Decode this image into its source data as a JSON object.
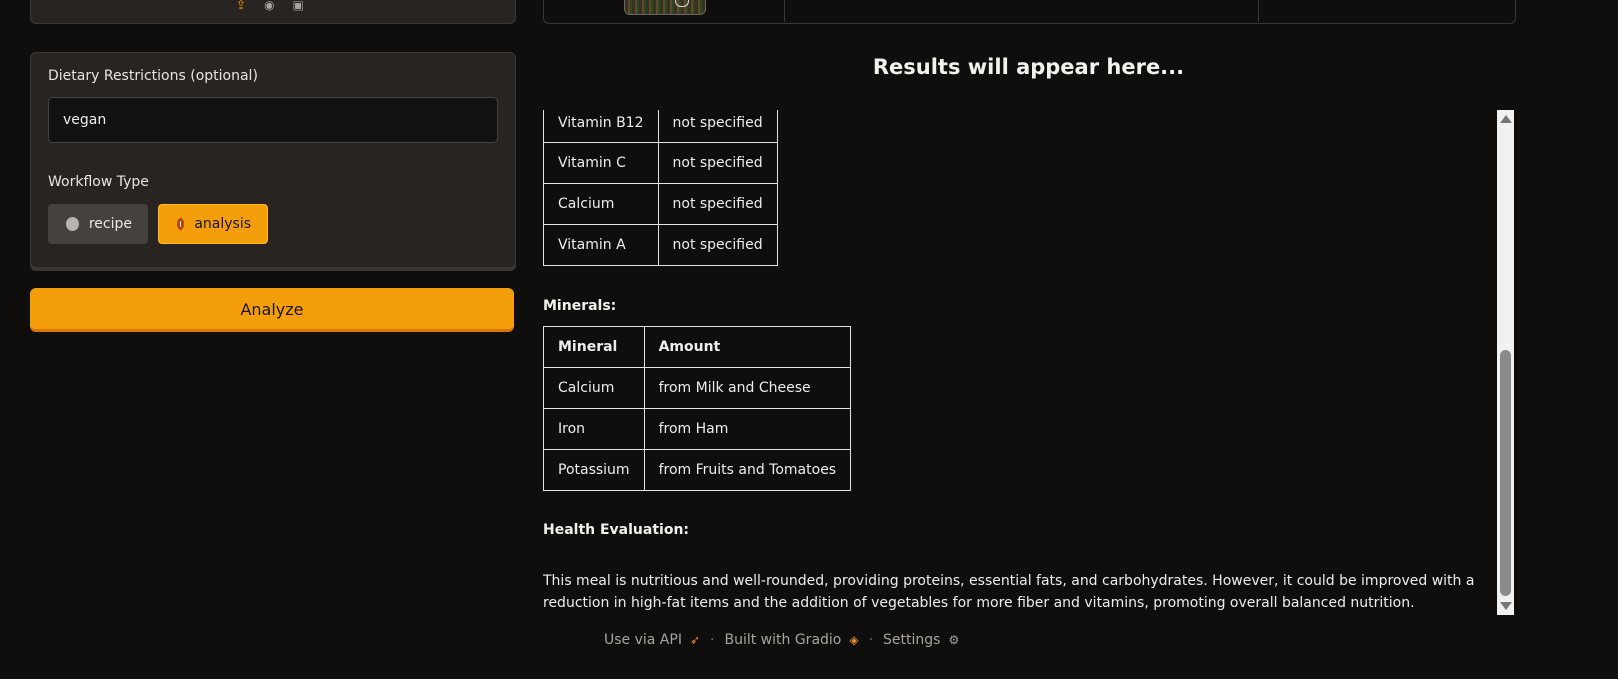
{
  "upload_panel": {
    "icons": [
      "upload-icon",
      "webcam-icon",
      "clipboard-icon"
    ]
  },
  "form": {
    "dietary_label": "Dietary Restrictions (optional)",
    "dietary_value": "vegan",
    "workflow_label": "Workflow Type",
    "options": [
      {
        "label": "recipe",
        "selected": false
      },
      {
        "label": "analysis",
        "selected": true
      }
    ]
  },
  "analyze_button": "Analyze",
  "results": {
    "title": "Results will appear here...",
    "vitamins": [
      {
        "name": "Vitamin B12",
        "amount": "not specified"
      },
      {
        "name": "Vitamin C",
        "amount": "not specified"
      },
      {
        "name": "Calcium",
        "amount": "not specified"
      },
      {
        "name": "Vitamin A",
        "amount": "not specified"
      }
    ],
    "minerals_heading": "Minerals:",
    "minerals_headers": [
      "Mineral",
      "Amount"
    ],
    "minerals": [
      {
        "name": "Calcium",
        "amount": "from Milk and Cheese"
      },
      {
        "name": "Iron",
        "amount": "from Ham"
      },
      {
        "name": "Potassium",
        "amount": "from Fruits and Tomatoes"
      }
    ],
    "health_heading": "Health Evaluation:",
    "health_text": "This meal is nutritious and well-rounded, providing proteins, essential fats, and carbohydrates. However, it could be improved with a reduction in high-fat items and the addition of vegetables for more fiber and vitamins, promoting overall balanced nutrition."
  },
  "footer": {
    "api": "Use via API",
    "built": "Built with Gradio",
    "settings": "Settings"
  },
  "colors": {
    "accent": "#f59e0b",
    "background": "#0f0e0d",
    "panel": "#272422"
  }
}
